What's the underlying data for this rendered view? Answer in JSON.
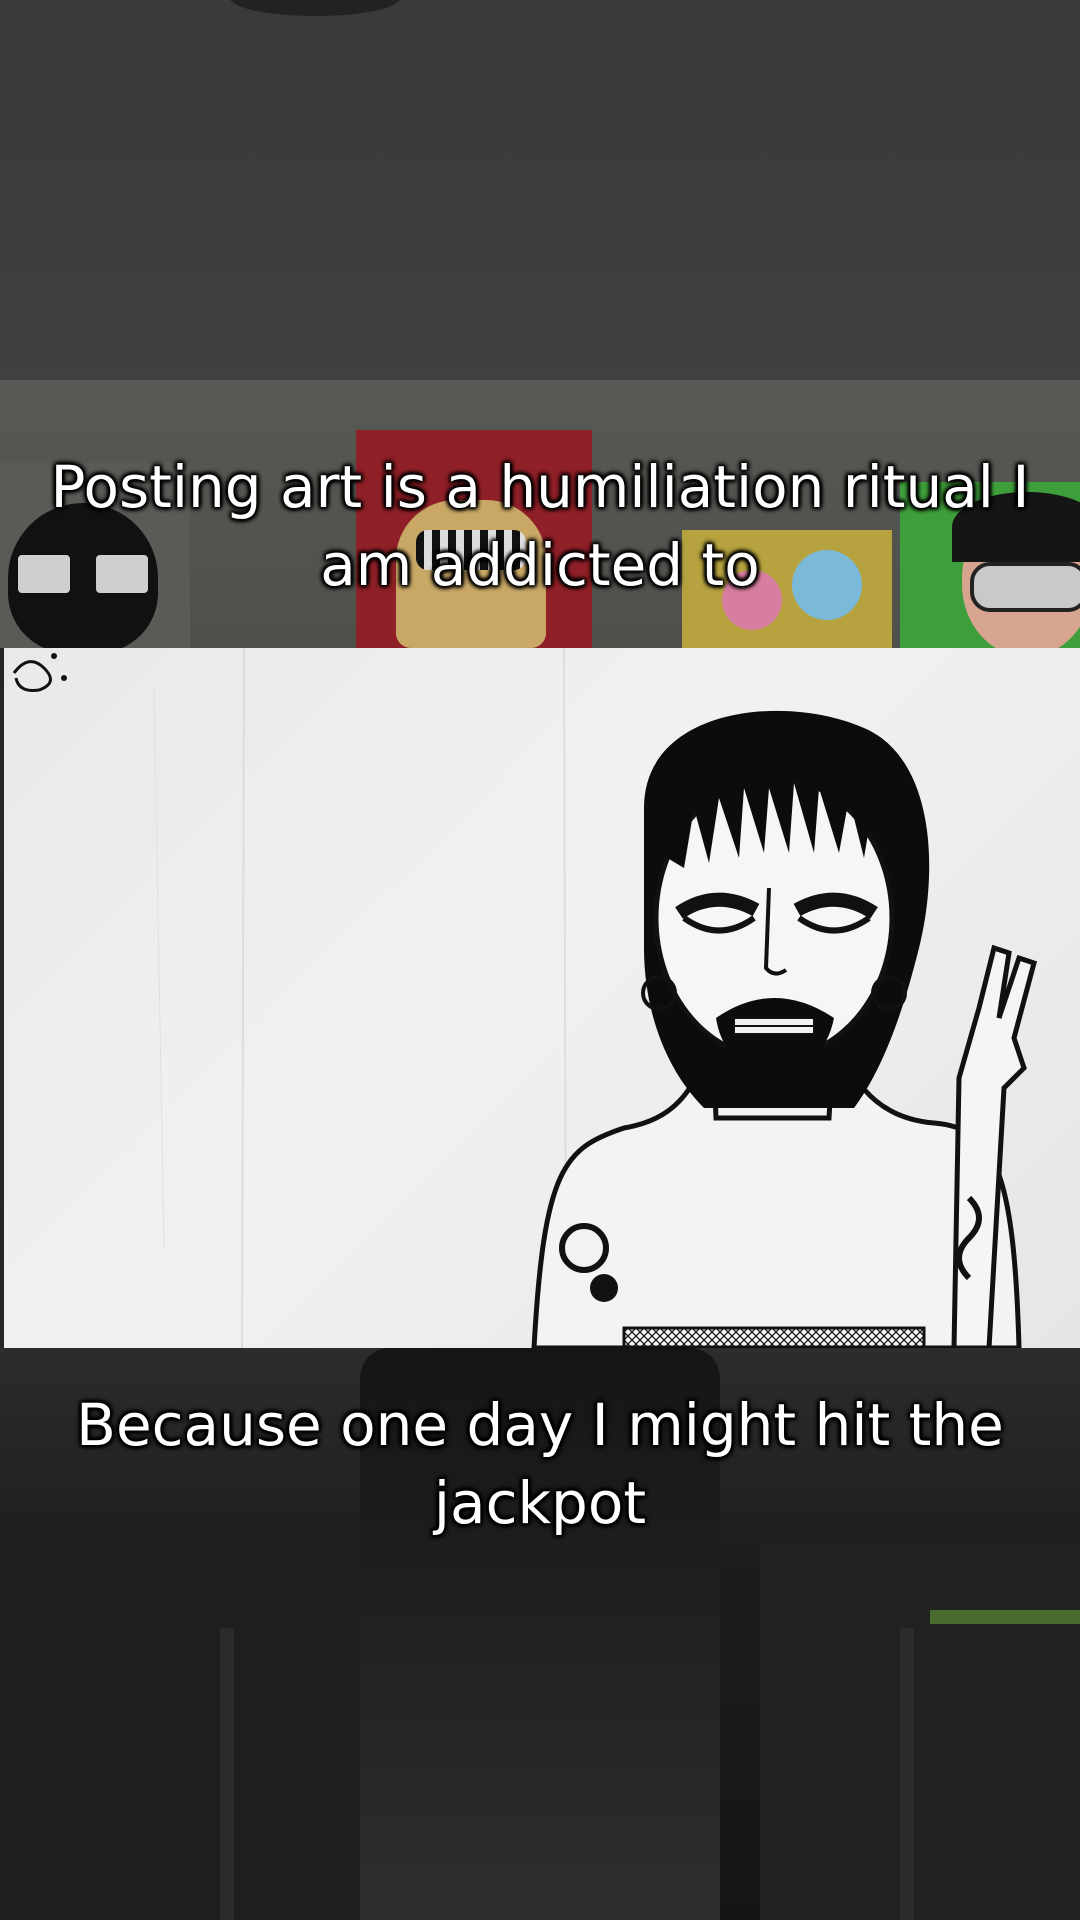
{
  "captions": {
    "top": "Posting art is a humiliation ritual I am addicted to",
    "bottom": "Because one day I might hit the jackpot"
  }
}
